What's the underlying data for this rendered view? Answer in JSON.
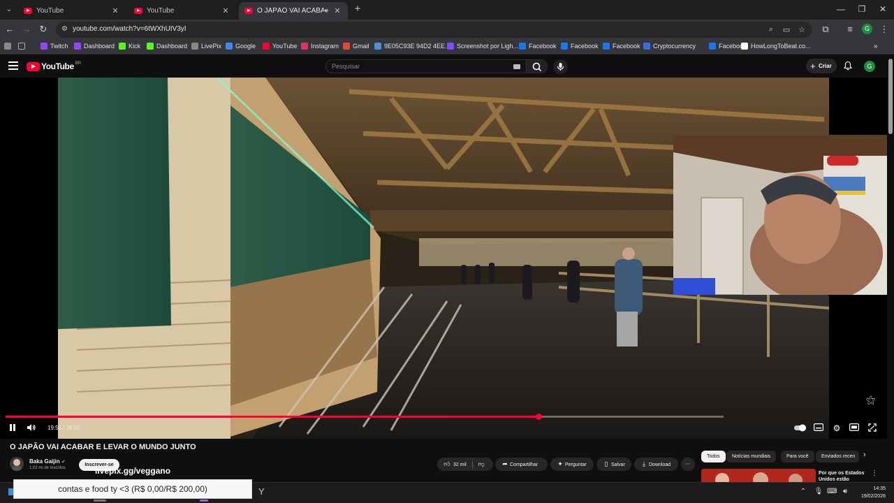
{
  "browser": {
    "tabs": [
      {
        "title": "YouTube",
        "active": false
      },
      {
        "title": "YouTube",
        "active": false
      },
      {
        "title": "O JAPÃO VAI ACABAR E LE…",
        "active": true,
        "audio": true
      }
    ],
    "url": "youtube.com/watch?v=6tWXhUIV3yI",
    "profile_initial": "G"
  },
  "bookmarks": [
    {
      "label": "Twitch",
      "icon": "twitch-icon",
      "color": "#9146ff"
    },
    {
      "label": "Dashboard",
      "icon": "twitch-icon",
      "color": "#9146ff"
    },
    {
      "label": "Kick",
      "icon": "kick-icon",
      "color": "#53fc18"
    },
    {
      "label": "Dashboard",
      "icon": "kick-icon",
      "color": "#53fc18"
    },
    {
      "label": "LivePix",
      "icon": "livepix-icon",
      "color": "#888888"
    },
    {
      "label": "Google",
      "icon": "google-icon",
      "color": "#4285f4"
    },
    {
      "label": "YouTube",
      "icon": "youtube-icon",
      "color": "#ff0033"
    },
    {
      "label": "Instagram",
      "icon": "instagram-icon",
      "color": "#e1306c"
    },
    {
      "label": "Gmail",
      "icon": "gmail-icon",
      "color": "#ea4335"
    },
    {
      "label": "9E05C93E 94D2 4EE...",
      "icon": "generic-site-icon",
      "color": "#4a90d9"
    },
    {
      "label": "Screenshot por Ligh...",
      "icon": "feather-icon",
      "color": "#7c4dff"
    },
    {
      "label": "Facebook",
      "icon": "facebook-icon",
      "color": "#1877f2"
    },
    {
      "label": "Facebook",
      "icon": "facebook-icon",
      "color": "#1877f2"
    },
    {
      "label": "Facebook",
      "icon": "facebook-icon",
      "color": "#1877f2"
    },
    {
      "label": "Cryptocurrency",
      "icon": "crypto-icon",
      "color": "#3c6be0"
    },
    {
      "label": "Facebook",
      "icon": "facebook-icon",
      "color": "#1877f2"
    },
    {
      "label": "HowLongToBeat.co...",
      "icon": "hltb-icon",
      "color": "#ffffff"
    }
  ],
  "youtube": {
    "logo_text": "YouTube",
    "logo_country": "BR",
    "search_placeholder": "Pesquisar",
    "create_label": "Criar",
    "avatar_initial": "G"
  },
  "player": {
    "current_time": "19:55",
    "duration": "26:50",
    "time_display": "19:55 / 26:50",
    "progress_fraction": 0.742,
    "playing": true,
    "accent": "#ff0033"
  },
  "video": {
    "title": "O JAPÃO VAI ACABAR E LEVAR O MUNDO JUNTO",
    "channel": "Baka Gaijin",
    "verified": true,
    "subscribers": "1,02 mi de inscritos",
    "subscribe_label": "Inscrever-se",
    "overlay_link": "livepix.gg/veggano",
    "likes": "32 mil",
    "actions": {
      "share": "Compartilhar",
      "ask": "Perguntar",
      "save": "Salvar",
      "download": "Download"
    }
  },
  "chips": [
    "Todos",
    "Notícias mundiais",
    "Para você",
    "Enviados recen"
  ],
  "recommendation": {
    "title": "Por que os Estados Unidos estão"
  },
  "stream_overlay": {
    "donation_text": "contas e food ty <3 (R$ 0,00/R$ 200,00)"
  },
  "taskbar": {
    "time": "14:35",
    "date": "19/02/2026"
  }
}
